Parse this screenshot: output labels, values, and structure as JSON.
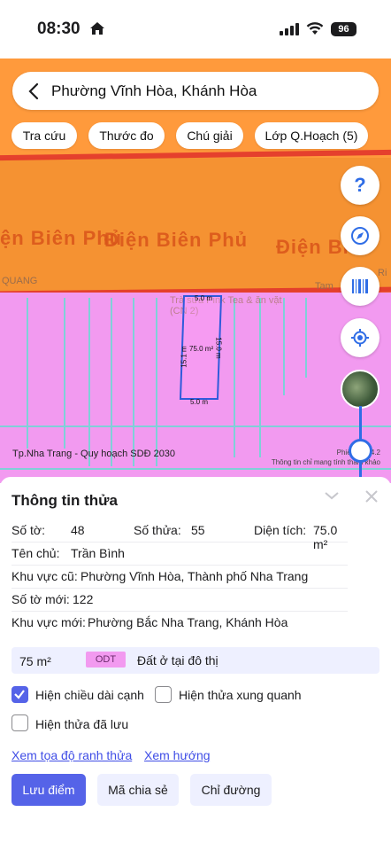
{
  "status_bar": {
    "time": "08:30",
    "battery": "96"
  },
  "search": {
    "text": "Phường Vĩnh Hòa, Khánh Hòa"
  },
  "chips": [
    "Tra cứu",
    "Thước đo",
    "Chú giải",
    "Lớp Q.Hoạch (5)"
  ],
  "map": {
    "road_labels": [
      "ện Biên Phủ",
      "Điện Biên Phủ",
      "Điện Bi"
    ],
    "overlay_labels": {
      "quang": "QUANG",
      "shop": "Trà sữa Pink Tea & ăn vặt (CN 2)",
      "tam": "Tam",
      "ri": "Ri"
    },
    "parcel": {
      "top": "5.0 m",
      "bottom": "5.0 m",
      "left": "15.1 m",
      "right": "15.0 m",
      "area": "75.0 m²"
    },
    "footer_left": "Tp.Nha Trang - Quy hoạch SDĐ 2030",
    "footer_right_1": "Phiên bản 4.2",
    "footer_right_2": "Thông tin chỉ mang tính tham khảo",
    "help_label": "?"
  },
  "panel": {
    "title": "Thông tin thửa",
    "so_to_label": "Số tờ:",
    "so_to": "48",
    "so_thua_label": "Số thửa:",
    "so_thua": "55",
    "dien_tich_label": "Diện tích:",
    "dien_tich": "75.0 m²",
    "chu_label": "Tên chủ:",
    "chu": "Trần Bình",
    "kv_cu_label": "Khu vực cũ:",
    "kv_cu": "Phường Vĩnh Hòa, Thành phố Nha Trang",
    "so_to_moi_label": "Số tờ mới:",
    "so_to_moi": "122",
    "kv_moi_label": "Khu vực mới:",
    "kv_moi": "Phường Bắc Nha Trang, Khánh Hòa",
    "land_area": "75 m²",
    "land_code": "ODT",
    "land_desc": "Đất ở tại đô thị",
    "checkboxes": [
      {
        "label": "Hiện chiều dài cạnh",
        "checked": true
      },
      {
        "label": "Hiện thửa xung quanh",
        "checked": false
      },
      {
        "label": "Hiện thửa đã lưu",
        "checked": false
      }
    ],
    "links": [
      "Xem tọa độ ranh thửa",
      "Xem hướng"
    ],
    "buttons": [
      "Lưu điểm",
      "Mã chia sẻ",
      "Chỉ đường"
    ]
  },
  "colors": {
    "accent": "#5563e8",
    "map_orange": "#ff9a3c",
    "map_pink": "#f29af0",
    "parcel_border": "#2f5bdb"
  }
}
